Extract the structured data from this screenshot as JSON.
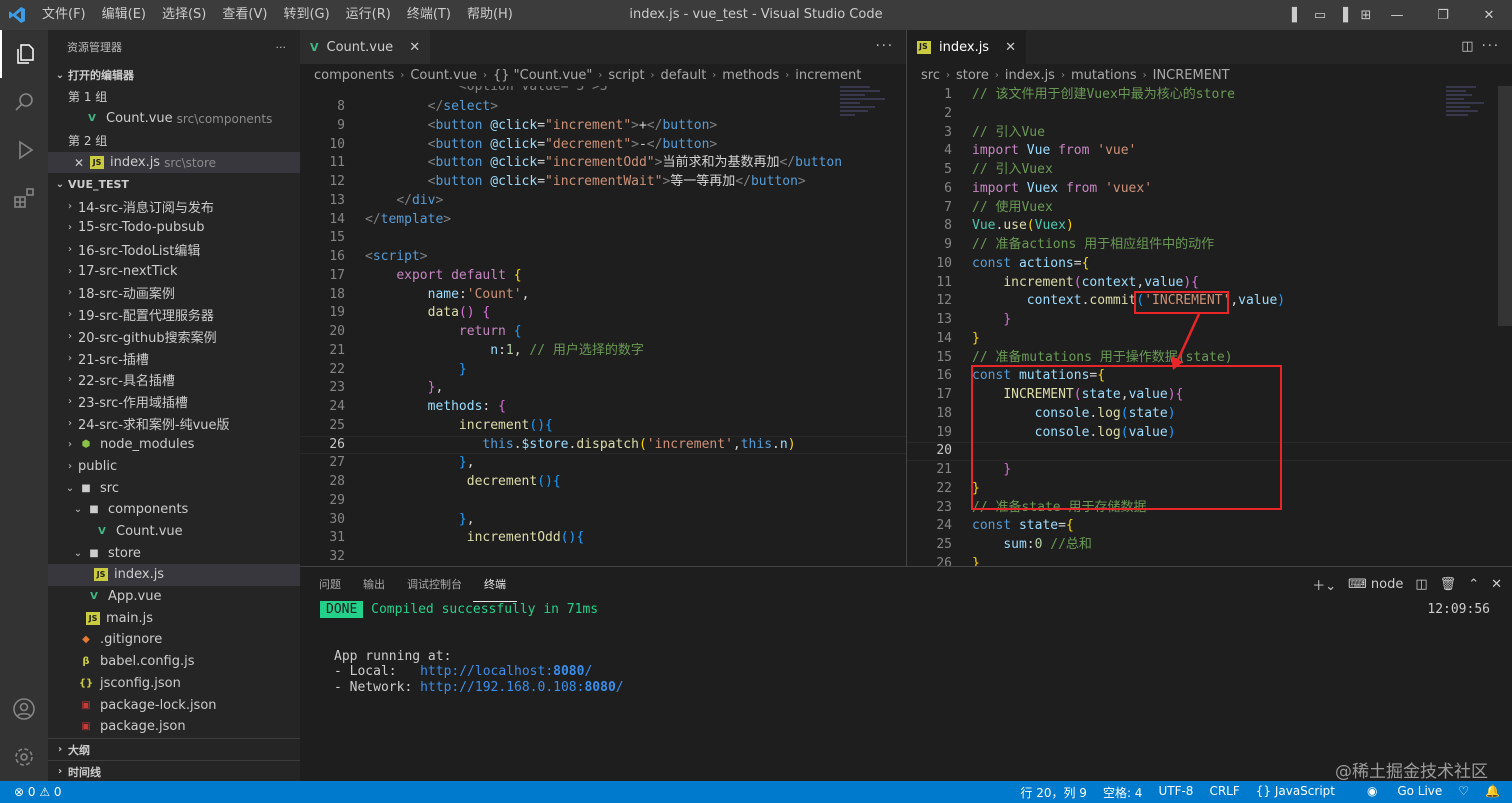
{
  "window": {
    "title": "index.js - vue_test - Visual Studio Code"
  },
  "menu": [
    "文件(F)",
    "编辑(E)",
    "选择(S)",
    "查看(V)",
    "转到(G)",
    "运行(R)",
    "终端(T)",
    "帮助(H)"
  ],
  "sidebar": {
    "title": "资源管理器",
    "more": "···",
    "open_editors": {
      "label": "打开的编辑器",
      "group1": "第 1 组",
      "group1_file": {
        "name": "Count.vue",
        "path": "src\\components"
      },
      "group2": "第 2 组",
      "group2_file": {
        "name": "index.js",
        "path": "src\\store"
      }
    },
    "project": "VUE_TEST",
    "tree": [
      {
        "name": "14-src-消息订阅与发布",
        "type": "folder",
        "indent": 0
      },
      {
        "name": "15-src-Todo-pubsub",
        "type": "folder",
        "indent": 0
      },
      {
        "name": "16-src-TodoList编辑",
        "type": "folder",
        "indent": 0
      },
      {
        "name": "17-src-nextTick",
        "type": "folder",
        "indent": 0
      },
      {
        "name": "18-src-动画案例",
        "type": "folder",
        "indent": 0
      },
      {
        "name": "19-src-配置代理服务器",
        "type": "folder",
        "indent": 0
      },
      {
        "name": "20-src-github搜索案例",
        "type": "folder",
        "indent": 0
      },
      {
        "name": "21-src-插槽",
        "type": "folder",
        "indent": 0
      },
      {
        "name": "22-src-具名插槽",
        "type": "folder",
        "indent": 0
      },
      {
        "name": "23-src-作用域插槽",
        "type": "folder",
        "indent": 0
      },
      {
        "name": "24-src-求和案例-纯vue版",
        "type": "folder",
        "indent": 0
      },
      {
        "name": "node_modules",
        "type": "node",
        "indent": 0
      },
      {
        "name": "public",
        "type": "folder",
        "indent": 0
      },
      {
        "name": "src",
        "type": "folder-open",
        "indent": 0
      },
      {
        "name": "components",
        "type": "folder-open",
        "indent": 1
      },
      {
        "name": "Count.vue",
        "type": "vue",
        "indent": 2
      },
      {
        "name": "store",
        "type": "folder-open",
        "indent": 1
      },
      {
        "name": "index.js",
        "type": "js",
        "indent": 2,
        "selected": true
      },
      {
        "name": "App.vue",
        "type": "vue",
        "indent": 1
      },
      {
        "name": "main.js",
        "type": "js",
        "indent": 1
      },
      {
        "name": ".gitignore",
        "type": "git",
        "indent": 0
      },
      {
        "name": "babel.config.js",
        "type": "babel",
        "indent": 0
      },
      {
        "name": "jsconfig.json",
        "type": "json",
        "indent": 0
      },
      {
        "name": "package-lock.json",
        "type": "npm",
        "indent": 0
      },
      {
        "name": "package.json",
        "type": "npm",
        "indent": 0
      }
    ],
    "outline": "大纲",
    "timeline": "时间线"
  },
  "editor_left": {
    "tab": "Count.vue",
    "crumbs": [
      "components",
      "Count.vue",
      "{} \"Count.vue\"",
      "script",
      "default",
      "methods",
      "increment"
    ],
    "partial_top": "option value=\"3\">3</option",
    "lines": [
      {
        "n": "8",
        "html": "        <span class=\"tag\">&lt;/</span><span class=\"tn\">select</span><span class=\"tag\">&gt;</span>"
      },
      {
        "n": "9",
        "html": "        <span class=\"tag\">&lt;</span><span class=\"tn\">button</span> <span class=\"at\">@click</span>=<span class=\"s\">\"increment\"</span><span class=\"tag\">&gt;</span>+<span class=\"tag\">&lt;/</span><span class=\"tn\">button</span><span class=\"tag\">&gt;</span>"
      },
      {
        "n": "10",
        "html": "        <span class=\"tag\">&lt;</span><span class=\"tn\">button</span> <span class=\"at\">@click</span>=<span class=\"s\">\"decrement\"</span><span class=\"tag\">&gt;</span>-<span class=\"tag\">&lt;/</span><span class=\"tn\">button</span><span class=\"tag\">&gt;</span>"
      },
      {
        "n": "11",
        "html": "        <span class=\"tag\">&lt;</span><span class=\"tn\">button</span> <span class=\"at\">@click</span>=<span class=\"s\">\"incrementOdd\"</span><span class=\"tag\">&gt;</span>当前求和为基数再加<span class=\"tag\">&lt;/</span><span class=\"tn\">button</span>"
      },
      {
        "n": "12",
        "html": "        <span class=\"tag\">&lt;</span><span class=\"tn\">button</span> <span class=\"at\">@click</span>=<span class=\"s\">\"incrementWait\"</span><span class=\"tag\">&gt;</span>等一等再加<span class=\"tag\">&lt;/</span><span class=\"tn\">button</span><span class=\"tag\">&gt;</span>"
      },
      {
        "n": "13",
        "html": "    <span class=\"tag\">&lt;/</span><span class=\"tn\">div</span><span class=\"tag\">&gt;</span>"
      },
      {
        "n": "14",
        "html": "<span class=\"tag\">&lt;/</span><span class=\"tn\">template</span><span class=\"tag\">&gt;</span>"
      },
      {
        "n": "15",
        "html": ""
      },
      {
        "n": "16",
        "html": "<span class=\"tag\">&lt;</span><span class=\"tn\">script</span><span class=\"tag\">&gt;</span>"
      },
      {
        "n": "17",
        "html": "    <span class=\"kc\">export</span> <span class=\"kc\">default</span> <span class=\"py\">{</span>"
      },
      {
        "n": "18",
        "html": "        <span class=\"v\">name</span>:<span class=\"s\">'Count'</span>,"
      },
      {
        "n": "19",
        "html": "        <span class=\"f\">data</span><span class=\"pr\">()</span> <span class=\"pr\">{</span>"
      },
      {
        "n": "20",
        "html": "            <span class=\"kc\">return</span> <span class=\"pb\">{</span>"
      },
      {
        "n": "21",
        "html": "                <span class=\"v\">n</span>:<span class=\"s\" style=\"color:#b5cea8\">1</span>, <span class=\"c\">// 用户选择的数字</span>"
      },
      {
        "n": "22",
        "html": "            <span class=\"pb\">}</span>"
      },
      {
        "n": "23",
        "html": "        <span class=\"pr\">}</span>,"
      },
      {
        "n": "24",
        "html": "        <span class=\"v\">methods</span>: <span class=\"pr\">{</span>"
      },
      {
        "n": "25",
        "html": "            <span class=\"f\">increment</span><span class=\"pb\">(){</span>"
      },
      {
        "n": "26",
        "html": "               <span class=\"k\">this</span>.<span class=\"v\">$store</span>.<span class=\"f\">dispatch</span><span class=\"py\">(</span><span class=\"s\">'increment'</span>,<span class=\"k\">this</span>.<span class=\"v\">n</span><span class=\"py\">)</span>",
        "cur": true
      },
      {
        "n": "27",
        "html": "            <span class=\"pb\">}</span>,"
      },
      {
        "n": "28",
        "html": "             <span class=\"f\">decrement</span><span class=\"pb\">(){</span>"
      },
      {
        "n": "29",
        "html": ""
      },
      {
        "n": "30",
        "html": "            <span class=\"pb\">}</span>,"
      },
      {
        "n": "31",
        "html": "             <span class=\"f\">incrementOdd</span><span class=\"pb\">(){</span>"
      },
      {
        "n": "32",
        "html": ""
      }
    ]
  },
  "editor_right": {
    "tab": "index.js",
    "crumbs": [
      "src",
      "store",
      "index.js",
      "mutations",
      "INCREMENT"
    ],
    "lines": [
      {
        "n": "1",
        "html": "<span class=\"c\">// 该文件用于创建Vuex中最为核心的store</span>"
      },
      {
        "n": "2",
        "html": ""
      },
      {
        "n": "3",
        "html": "<span class=\"c\">// 引入Vue</span>"
      },
      {
        "n": "4",
        "html": "<span class=\"kc\">import</span> <span class=\"v\">Vue</span> <span class=\"kc\">from</span> <span class=\"s\">'vue'</span>"
      },
      {
        "n": "5",
        "html": "<span class=\"c\">// 引入Vuex</span>"
      },
      {
        "n": "6",
        "html": "<span class=\"kc\">import</span> <span class=\"v\">Vuex</span> <span class=\"kc\">from</span> <span class=\"s\">'vuex'</span>"
      },
      {
        "n": "7",
        "html": "<span class=\"c\">// 使用Vuex</span>"
      },
      {
        "n": "8",
        "html": "<span class=\"t\">Vue</span>.<span class=\"f\">use</span><span class=\"py\">(</span><span class=\"t\">Vuex</span><span class=\"py\">)</span>"
      },
      {
        "n": "9",
        "html": "<span class=\"c\">// 准备actions 用于相应组件中的动作</span>"
      },
      {
        "n": "10",
        "html": "<span class=\"k\">const</span> <span class=\"v\">actions</span>=<span class=\"py\">{</span>"
      },
      {
        "n": "11",
        "html": "    <span class=\"f\">increment</span><span class=\"pr\">(</span><span class=\"v\">context</span>,<span class=\"v\">value</span><span class=\"pr\">){</span>"
      },
      {
        "n": "12",
        "html": "       <span class=\"v\">context</span>.<span class=\"f\">commit</span><span class=\"pb\">(</span><span class=\"s\">'INCREMENT'</span>,<span class=\"v\">value</span><span class=\"pb\">)</span>"
      },
      {
        "n": "13",
        "html": "    <span class=\"pr\">}</span>"
      },
      {
        "n": "14",
        "html": "<span class=\"py\">}</span>"
      },
      {
        "n": "15",
        "html": "<span class=\"c\">// 准备mutations 用于操作数据(state)</span>"
      },
      {
        "n": "16",
        "html": "<span class=\"k\">const</span> <span class=\"v\">mutations</span>=<span class=\"py\">{</span>"
      },
      {
        "n": "17",
        "html": "    <span class=\"f\">INCREMENT</span><span class=\"pr\">(</span><span class=\"v\">state</span>,<span class=\"v\">value</span><span class=\"pr\">){</span>"
      },
      {
        "n": "18",
        "html": "        <span class=\"v\">console</span>.<span class=\"f\">log</span><span class=\"pb\">(</span><span class=\"v\">state</span><span class=\"pb\">)</span>"
      },
      {
        "n": "19",
        "html": "        <span class=\"v\">console</span>.<span class=\"f\">log</span><span class=\"pb\">(</span><span class=\"v\">value</span><span class=\"pb\">)</span>"
      },
      {
        "n": "20",
        "html": "",
        "cur": true
      },
      {
        "n": "21",
        "html": "    <span class=\"pr\">}</span>"
      },
      {
        "n": "22",
        "html": "<span class=\"py\">}</span>"
      },
      {
        "n": "23",
        "html": "<span class=\"c\">// 准备state 用于存储数据</span>"
      },
      {
        "n": "24",
        "html": "<span class=\"k\">const</span> <span class=\"v\">state</span>=<span class=\"py\">{</span>"
      },
      {
        "n": "25",
        "html": "    <span class=\"v\">sum</span>:<span style=\"color:#b5cea8\">0</span> <span class=\"c\">//总和</span>"
      },
      {
        "n": "26",
        "html": "<span class=\"py\">}</span>"
      }
    ]
  },
  "panel": {
    "tabs": [
      "问题",
      "输出",
      "调试控制台",
      "终端"
    ],
    "active_tab": "终端",
    "shell": "node",
    "done_badge": "DONE",
    "compiled": "Compiled successfully in 71ms",
    "time": "12:09:56",
    "app_running": "App running at:",
    "local_label": "- Local:   ",
    "local_url": "http://localhost:",
    "local_port": "8080",
    "network_label": "- Network: ",
    "network_url": "http://192.168.0.108:",
    "network_port": "8080"
  },
  "status": {
    "errors": "⊗ 0",
    "warnings": "⚠ 0",
    "position": "行 20，列 9",
    "spaces": "空格: 4",
    "encoding": "UTF-8",
    "eol": "CRLF",
    "language": "{} JavaScript",
    "golive": "Go Live"
  },
  "watermark": "@稀土掘金技术社区",
  "colors": {
    "accent": "#007acc",
    "annotation": "#e8262a"
  }
}
